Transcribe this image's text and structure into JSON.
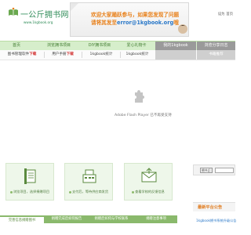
{
  "site": {
    "name": "一公斤拥书网",
    "domain": "www.1kgbook.org"
  },
  "banner": {
    "line1": "欢迎大家踊跃参与，如果您发现了问题",
    "line2_prefix": "请将其发至",
    "email": "error@1kgbook.org",
    "line2_suffix": "哦"
  },
  "top_links": [
    "设为",
    "首页"
  ],
  "nav": [
    {
      "label": "首页",
      "style": "light"
    },
    {
      "label": "浏览拥书项目",
      "style": "light"
    },
    {
      "label": "DIY拥书项目",
      "style": "light"
    },
    {
      "label": "爱心礼物卡",
      "style": "light"
    },
    {
      "label": "我的1kgbook",
      "style": "dark"
    },
    {
      "label": "浏览分享日志",
      "style": "dark"
    }
  ],
  "subnav": [
    {
      "label": "图书管理软件",
      "download": "下载",
      "style": "plain"
    },
    {
      "label": "用户手册",
      "download": "下载",
      "style": "plain"
    },
    {
      "label": "1kgbook统计",
      "style": "plain"
    },
    {
      "label": "1kgbook统计",
      "style": "plain"
    },
    {
      "label": "",
      "style": "grey"
    },
    {
      "label": "书籍推荐",
      "style": "grey"
    }
  ],
  "flash": {
    "message": "Adobe Flash Player 已不再受支持"
  },
  "cards": [
    {
      "caption": "浏览项目，选择捐赠项目",
      "icon": "book-stack-icon"
    },
    {
      "caption": "支付后，等待供应商发货",
      "icon": "cash-register-icon"
    },
    {
      "caption": "查看学校的反馈信息",
      "icon": "envelope-icon"
    }
  ],
  "bottom_tabs": [
    {
      "label": "完善信息捐赠图书",
      "active": true
    },
    {
      "label": "捐赠完成后如何报告",
      "active": false
    },
    {
      "label": "捐赠后如何与学校联系",
      "active": false
    },
    {
      "label": "捐赠注意事项",
      "active": false
    }
  ],
  "search": {
    "select_value": "拥书方"
  },
  "notice": {
    "title": "最新平台公告",
    "item": "1kgbook拥书系统升级公告"
  },
  "colors": {
    "brand_green": "#2e8b57",
    "nav_bg": "#d6eecb",
    "accent_orange": "#e8801a",
    "link_blue": "#2a78c8"
  }
}
